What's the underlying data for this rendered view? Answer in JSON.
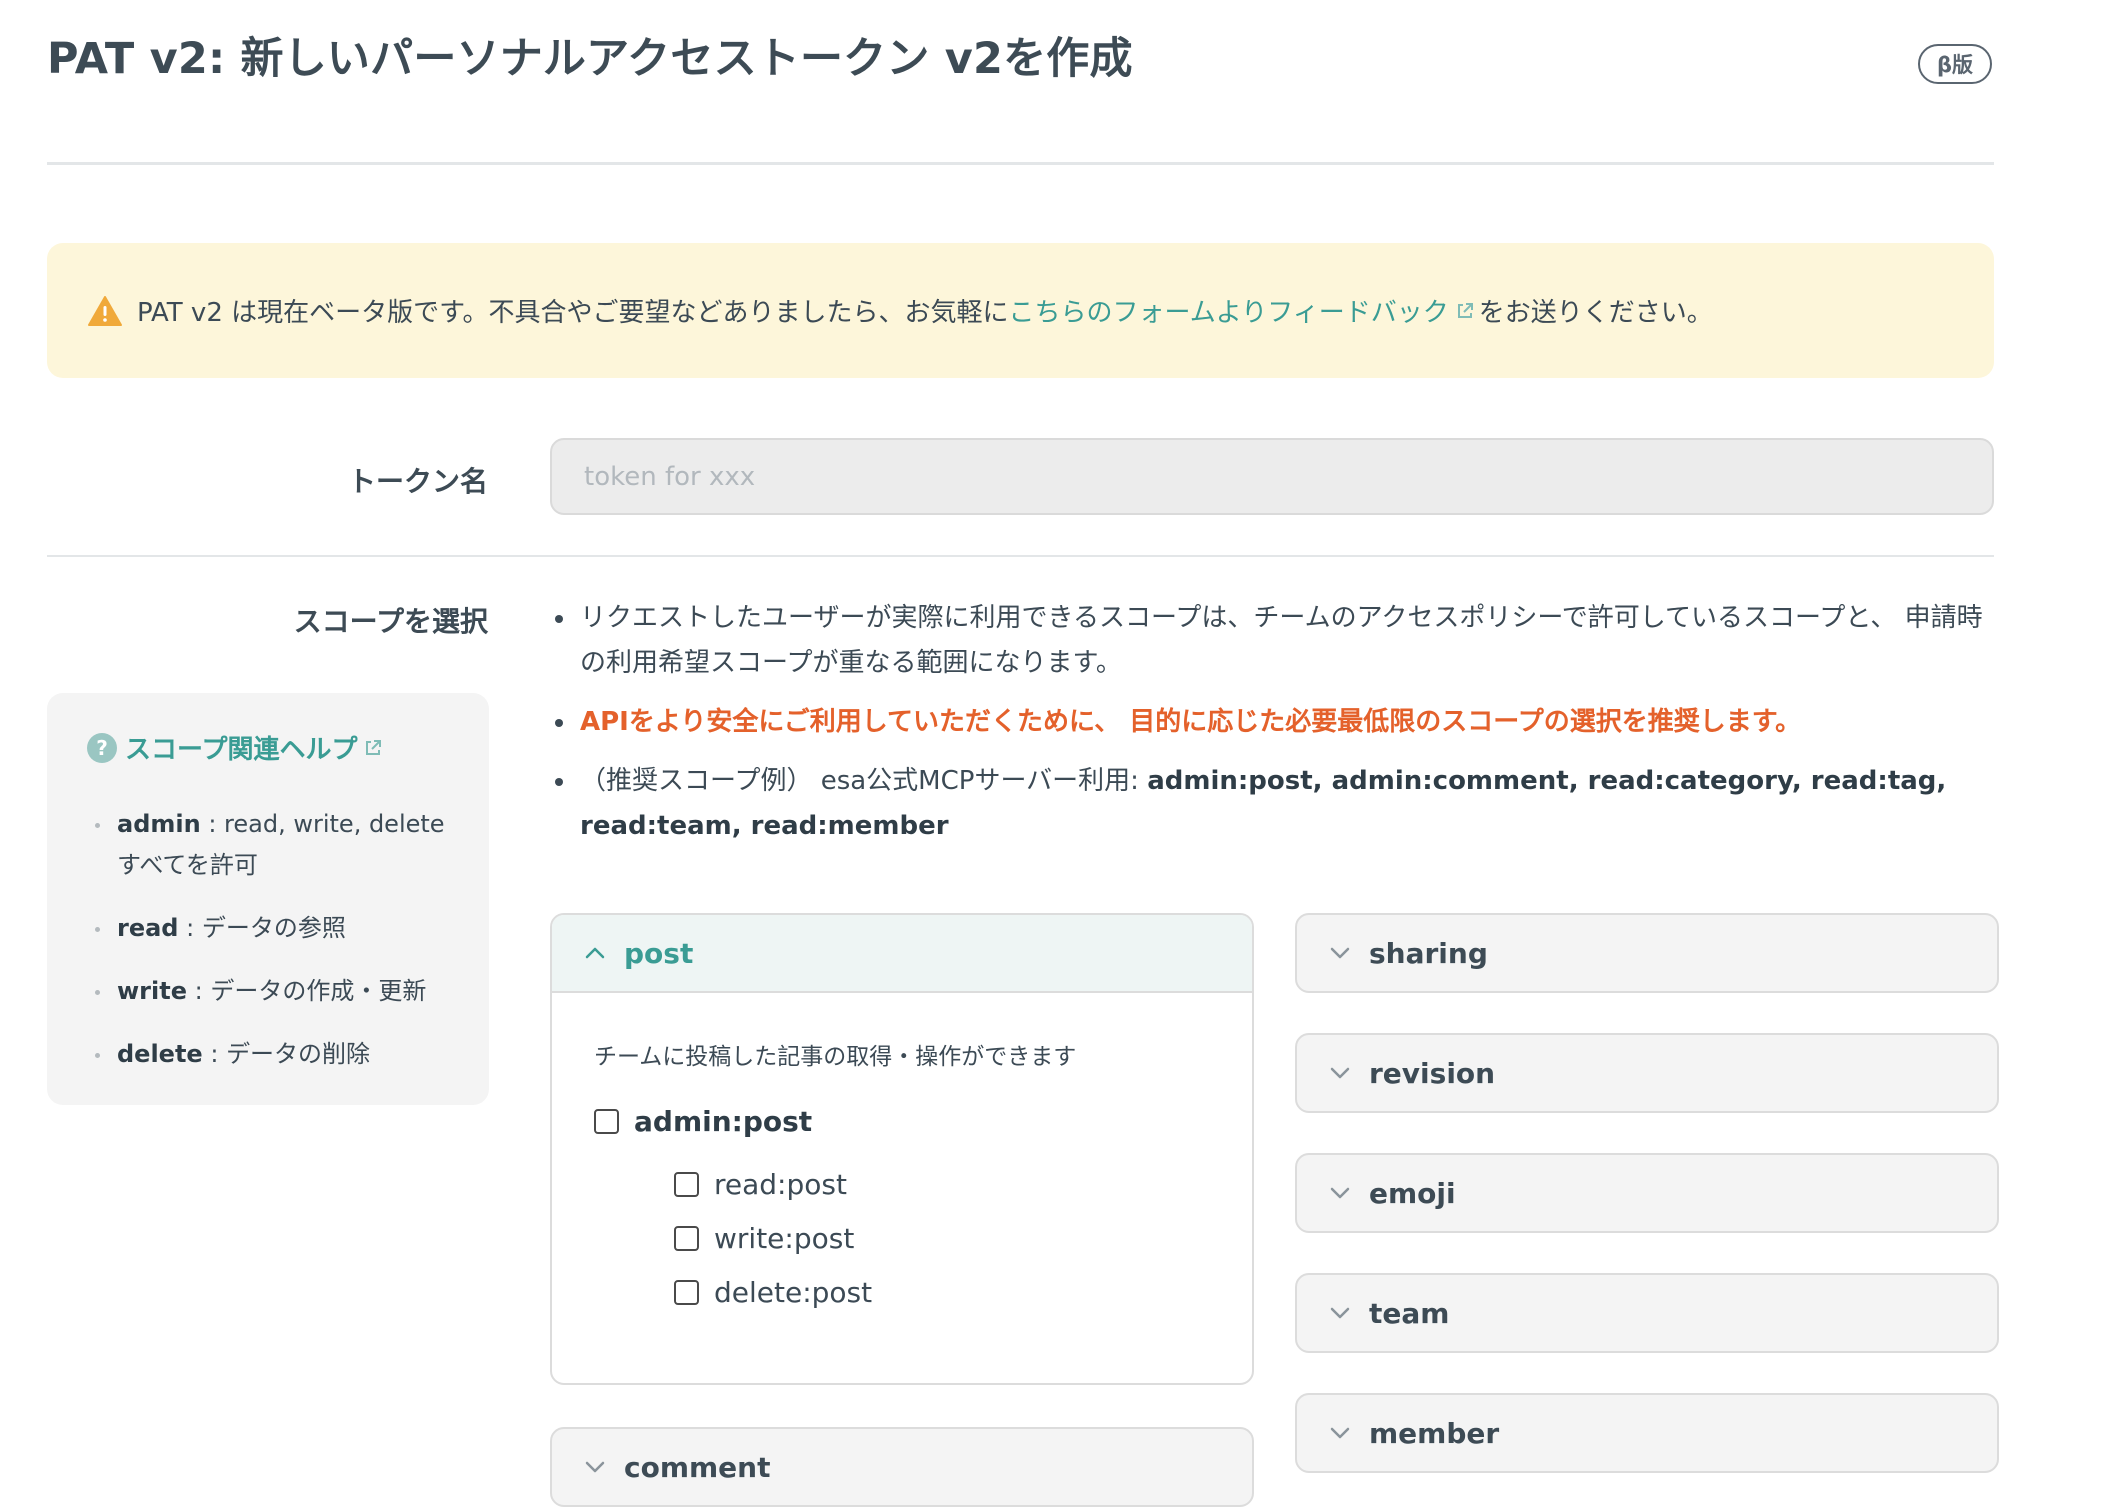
{
  "header": {
    "title": "PAT v2: 新しいパーソナルアクセストークン v2を作成",
    "badge": "β版"
  },
  "alert": {
    "icon": "warning-icon",
    "text_before": "PAT v2 は現在ベータ版です。不具合やご要望などありましたら、お気軽に ",
    "link_text": "こちらのフォームよりフィードバック",
    "text_after": "をお送りください。"
  },
  "token": {
    "label": "トークン名",
    "placeholder": "token for xxx",
    "value": ""
  },
  "scope": {
    "label": "スコープを選択",
    "help": {
      "title": "スコープ関連ヘルプ",
      "items": [
        {
          "term": "admin",
          "desc": " : read, write, delete すべてを許可"
        },
        {
          "term": "read",
          "desc": " : データの参照"
        },
        {
          "term": "write",
          "desc": " : データの作成・更新"
        },
        {
          "term": "delete",
          "desc": " : データの削除"
        }
      ]
    },
    "notes": {
      "n1": "リクエストしたユーザーが実際に利用できるスコープは、チームのアクセスポリシーで許可しているスコープと、 申請時の利用希望スコープが重なる範囲になります。",
      "n2": "APIをより安全にご利用していただくために、 目的に応じた必要最低限のスコープの選択を推奨します。",
      "n3_prefix": "（推奨スコープ例） esa公式MCPサーバー利用: ",
      "n3_scopes": "admin:post, admin:comment, read:category, read:tag, read:team, read:member"
    },
    "groups": {
      "post": {
        "name": "post",
        "description": "チームに投稿した記事の取得・操作ができます",
        "admin": "admin:post",
        "read": "read:post",
        "write": "write:post",
        "delete": "delete:post"
      },
      "comment": "comment",
      "sharing": "sharing",
      "revision": "revision",
      "emoji": "emoji",
      "team": "team",
      "member": "member"
    }
  },
  "colors": {
    "accent": "#3a9c94",
    "warning_text": "#e4612b",
    "alert_bg": "#fdf6da"
  }
}
